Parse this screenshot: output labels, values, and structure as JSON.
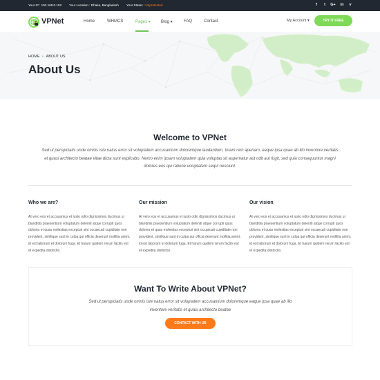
{
  "topbar": {
    "ip_label": "Your IP : 192.168.0.102",
    "location_label": "Your Location : Dhaka, Bangladesh",
    "status_prefix": "Your Status : ",
    "status_value": "Unprotected",
    "status_color": "#ff7a1a",
    "social": [
      {
        "icon": "facebook-icon",
        "glyph": "f"
      },
      {
        "icon": "twitter-icon",
        "glyph": "t"
      },
      {
        "icon": "google-plus-icon",
        "glyph": "G+"
      },
      {
        "icon": "linkedin-icon",
        "glyph": "in"
      },
      {
        "icon": "vimeo-icon",
        "glyph": "v"
      }
    ]
  },
  "brand": {
    "name": "VPNet",
    "accent": "#7ed957",
    "orange": "#ff7a1a",
    "dark": "#222831"
  },
  "nav": {
    "items": [
      "Home",
      "WHMCS",
      "Pages ▾",
      "Blog ▾",
      "FAQ",
      "Contact"
    ],
    "active_index": 2,
    "account": "My Account ▾",
    "cta": "TRY IT FREE"
  },
  "hero": {
    "breadcrumb_home": "HOME",
    "breadcrumb_sep": "»",
    "breadcrumb_current": "ABOUT US",
    "title": "About Us"
  },
  "welcome": {
    "title": "Welcome to VPNet",
    "text": "Sed ut perspiciatis unde omnis iste natus error sit voluptatem accusantium doloremque laudantium, totam rem aperiam, eaque ipsa quae ab illo inventore veritatis et quasi architecto beatae vitae dicta sunt explicabo. Nemo enim ipsam voluptatem quia voluptas sit aspernatur aut odit aut fugit, sed quia consequuntur magni dolores eos qui ratione voluptatem sequi nesciunt."
  },
  "columns": [
    {
      "title": "Who we are?",
      "text": "At vero eos et accusamus et iusto odio dignissimos ducimus ui blanditiis praesentium voluptatum deleniti atque corrupti quos dolores et quas molestias excepturi sint occaecati cupiditate non provident, similique sunt in culpa qui officia deserunt mollitia animi, id est laborum et dolorum fuga. Et harum quidem rerum facilis est et expedita distinctio."
    },
    {
      "title": "Our mission",
      "text": "At vero eos et accusamus et iusto odio dignissimos ducimus ui blanditiis praesentium voluptatum deleniti atque corrupti quos dolores et quas molestias excepturi sint occaecati cupiditate non provident, similique sunt in culpa qui officia deserunt mollitia animi, id est laborum et dolorum fuga. Et harum quidem rerum facilis est et expedita distinctio."
    },
    {
      "title": "Our vision",
      "text": "At vero eos et accusamus et iusto odio dignissimos ducimus ui blanditiis praesentium voluptatum deleniti atque corrupti quos dolores et quas molestias excepturi sint occaecati cupiditate non provident, similique sunt in culpa qui officia deserunt mollitia animi, id est laborum et dolorum fuga. Et harum quidem rerum facilis est et expedita distinctio."
    }
  ],
  "cta_box": {
    "title": "Want To Write About VPNet?",
    "text": "Sed ut perspiciatis unde omnis iste natus error sit voluptatem accusantium doloremque eaque ipsa quae ab illo inventore veritatis et quasi architecto beatae",
    "button": "CONTACT WITH US"
  }
}
